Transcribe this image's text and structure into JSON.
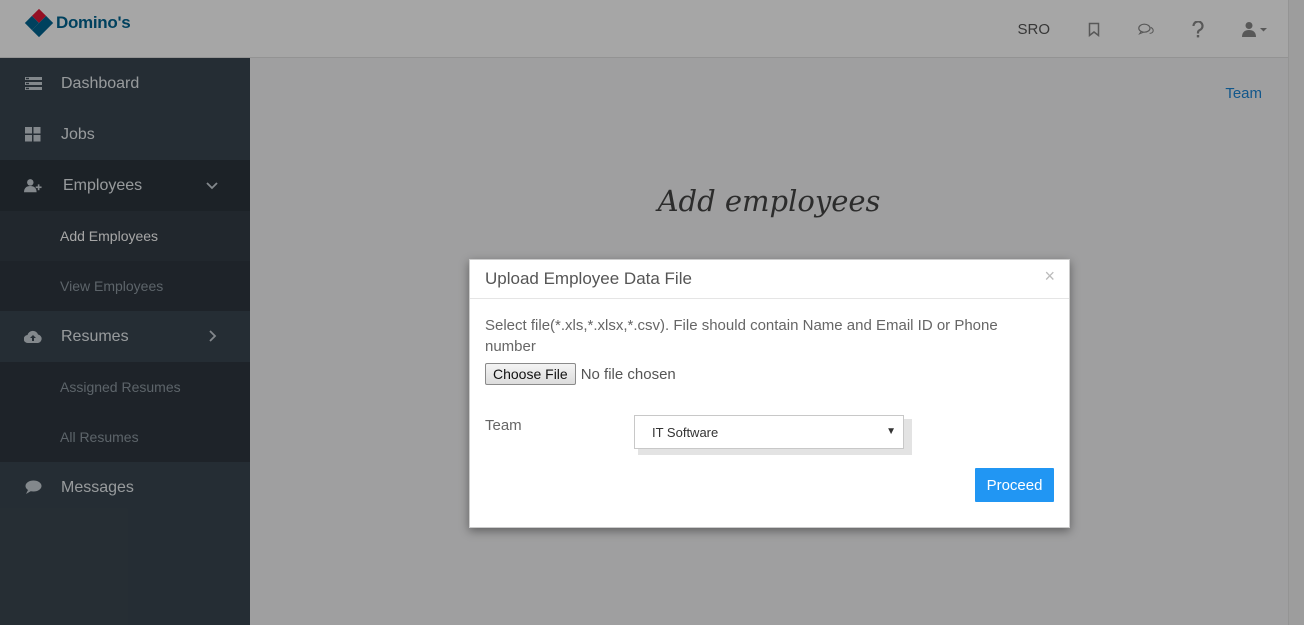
{
  "header": {
    "brand": "Domino's",
    "user_code": "SRO",
    "icons": [
      "bookmark-icon",
      "chat-icon",
      "help-icon",
      "user-icon"
    ]
  },
  "sidebar": {
    "items": [
      {
        "label": "Dashboard",
        "icon": "dashboard-icon"
      },
      {
        "label": "Jobs",
        "icon": "grid-icon"
      },
      {
        "label": "Employees",
        "icon": "user-plus-icon",
        "expanded": true,
        "children": [
          {
            "label": "Add Employees",
            "current": true
          },
          {
            "label": "View Employees"
          }
        ]
      },
      {
        "label": "Resumes",
        "icon": "cloud-upload-icon",
        "expanded": false,
        "children": [
          {
            "label": "Assigned Resumes"
          },
          {
            "label": "All Resumes"
          }
        ]
      },
      {
        "label": "Messages",
        "icon": "message-icon"
      }
    ]
  },
  "main": {
    "team_link": "Team",
    "page_title": "Add employees"
  },
  "modal": {
    "title": "Upload Employee Data File",
    "close_symbol": "×",
    "hint": "Select file(*.xls,*.xlsx,*.csv). File should contain Name and Email ID or Phone number",
    "file_button": "Choose File",
    "file_status": "No file chosen",
    "team_label": "Team",
    "team_selected": "IT Software",
    "proceed_label": "Proceed"
  },
  "colors": {
    "sidebar_bg": "#3a4650",
    "accent": "#2196f3",
    "link": "#1d86d6",
    "brand_blue": "#006491",
    "brand_red": "#e31837"
  }
}
